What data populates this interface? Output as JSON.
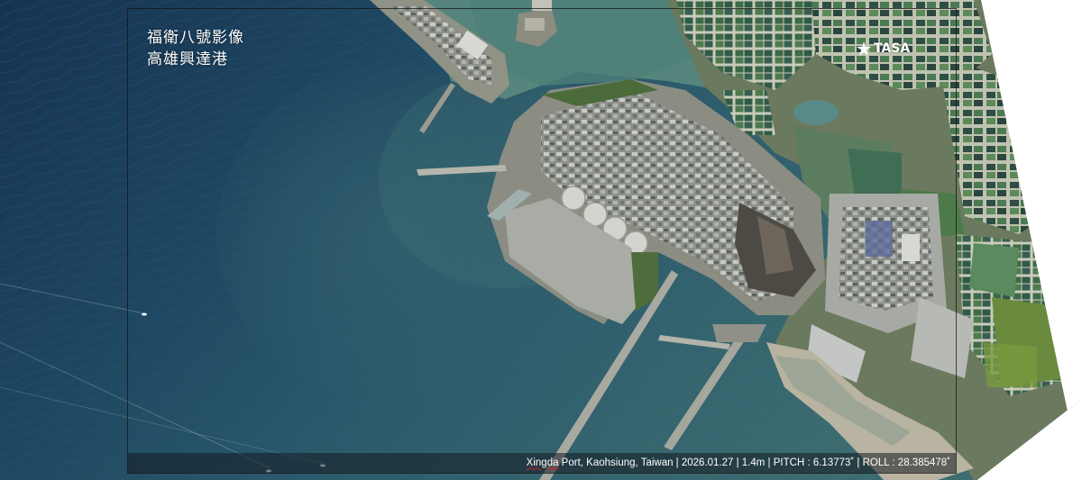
{
  "image": {
    "title_line_1": "福衛八號影像",
    "title_line_2": "高雄興達港",
    "logo_text": "TASA",
    "caption_place_word": "Xingda",
    "caption_rest": " Port, Kaohsiung, Taiwan | 2026.01.27 | 1.4m | PITCH : 6.13773˚ | ROLL : 28.385478˚"
  },
  "colors": {
    "sea_deep": "#1c3a5c",
    "sea_mid": "#2b5a6e",
    "sea_shallow": "#4f7f7a",
    "land": "#6f7a62",
    "aquaculture": "#3f6a4c",
    "industrial": "#9a9a92",
    "text": "#ffffff"
  },
  "icons": {
    "logo": "tasa-star-icon"
  }
}
